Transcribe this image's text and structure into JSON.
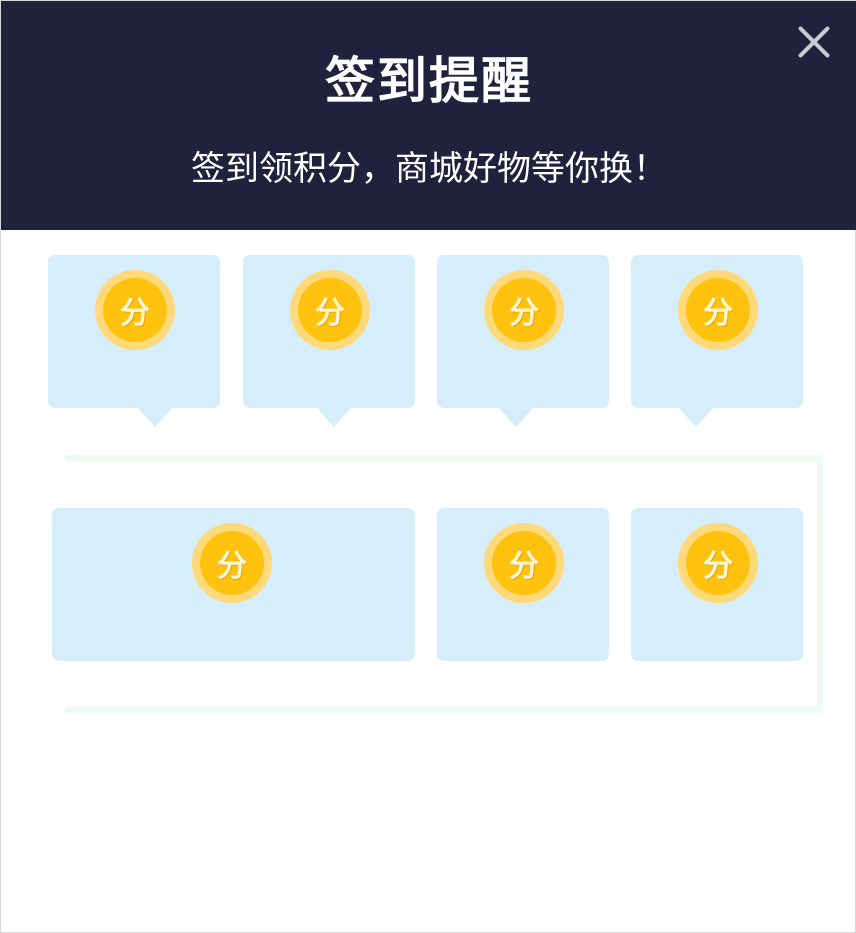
{
  "modal": {
    "title": "签到提醒",
    "subtitle": "签到领积分，商城好物等你换！"
  },
  "close_icon": "close-icon",
  "colors": {
    "header_bg": "#20223d",
    "card_bg": "#d6eefa",
    "coin_outer": "#ffd97a",
    "coin_inner": "#ffc20e",
    "path_line": "#eefbf2"
  },
  "coin_label": "分",
  "cards": [
    {
      "label": "分"
    },
    {
      "label": "分"
    },
    {
      "label": "分"
    },
    {
      "label": "分"
    },
    {
      "label": "分"
    },
    {
      "label": "分"
    },
    {
      "label": "分"
    }
  ]
}
